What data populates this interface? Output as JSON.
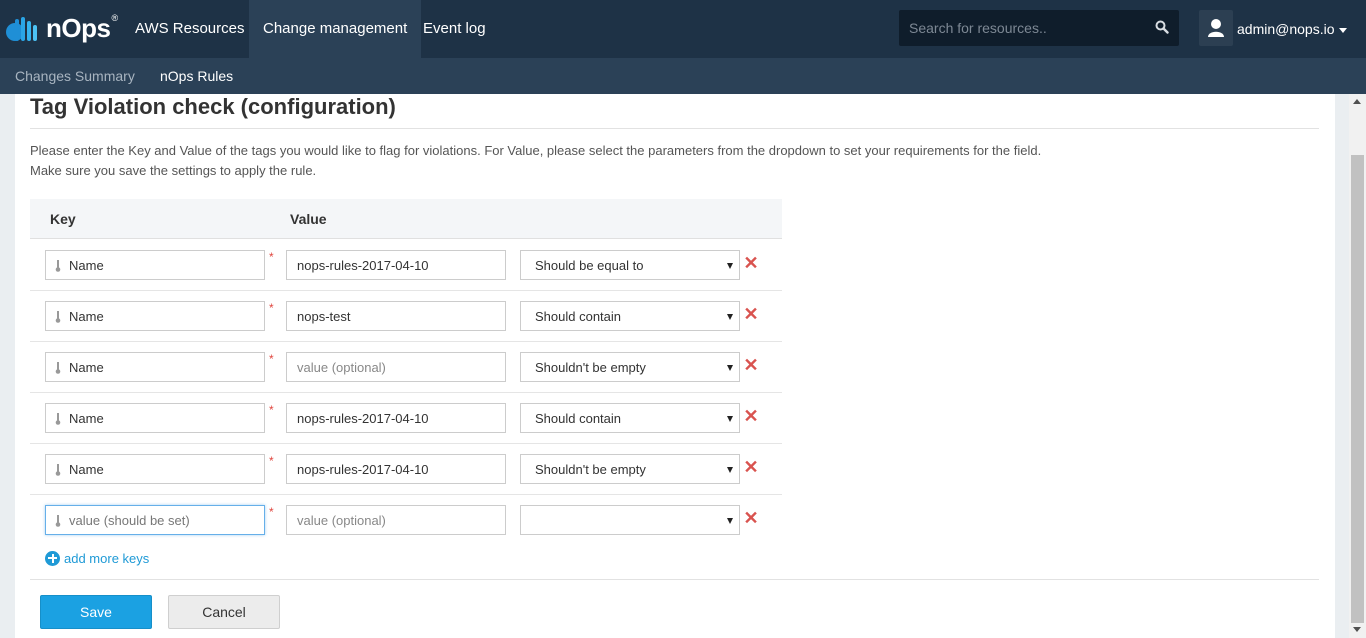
{
  "brand": {
    "name": "nOps",
    "registered": "®"
  },
  "nav": {
    "items": [
      {
        "label": "AWS Resources"
      },
      {
        "label": "Change management"
      },
      {
        "label": "Event log"
      }
    ]
  },
  "search": {
    "placeholder": "Search for resources.."
  },
  "user": {
    "label": "admin@nops.io"
  },
  "subnav": {
    "items": [
      {
        "label": "Changes Summary"
      },
      {
        "label": "nOps Rules"
      }
    ]
  },
  "page": {
    "title": "Tag Violation check (configuration)",
    "description_line1": "Please enter the Key and Value of the tags you would like to flag for violations. For Value, please select the parameters from the dropdown to set your requirements for the field.",
    "description_line2": "Make sure you save the settings to apply the rule."
  },
  "table": {
    "headers": {
      "key": "Key",
      "value": "Value"
    },
    "required_mark": "*",
    "delete_glyph": "✕",
    "rows": [
      {
        "key": "Name",
        "key_placeholder": "value (should be set)",
        "value": "nops-rules-2017-04-10",
        "value_placeholder": "value (optional)",
        "condition": "Should be equal to"
      },
      {
        "key": "Name",
        "key_placeholder": "value (should be set)",
        "value": "nops-test",
        "value_placeholder": "value (optional)",
        "condition": "Should contain"
      },
      {
        "key": "Name",
        "key_placeholder": "value (should be set)",
        "value": "",
        "value_placeholder": "value (optional)",
        "condition": "Shouldn't be empty"
      },
      {
        "key": "Name",
        "key_placeholder": "value (should be set)",
        "value": "nops-rules-2017-04-10",
        "value_placeholder": "value (optional)",
        "condition": "Should contain"
      },
      {
        "key": "Name",
        "key_placeholder": "value (should be set)",
        "value": "nops-rules-2017-04-10",
        "value_placeholder": "value (optional)",
        "condition": "Shouldn't be empty"
      },
      {
        "key": "",
        "key_placeholder": "value (should be set)",
        "value": "",
        "value_placeholder": "value (optional)",
        "condition": ""
      }
    ]
  },
  "actions": {
    "add_more": "add more keys",
    "save": "Save",
    "cancel": "Cancel"
  },
  "colors": {
    "navbar": "#1e3246",
    "subnav": "#2b4157",
    "accent": "#1ba1e2",
    "delete": "#d9534f"
  },
  "icons": {
    "logo": "nops-cloud-logo-icon",
    "search": "search-icon",
    "user": "user-icon",
    "key": "thermometer-key-icon",
    "delete": "close-icon",
    "add": "plus-circle-icon"
  }
}
